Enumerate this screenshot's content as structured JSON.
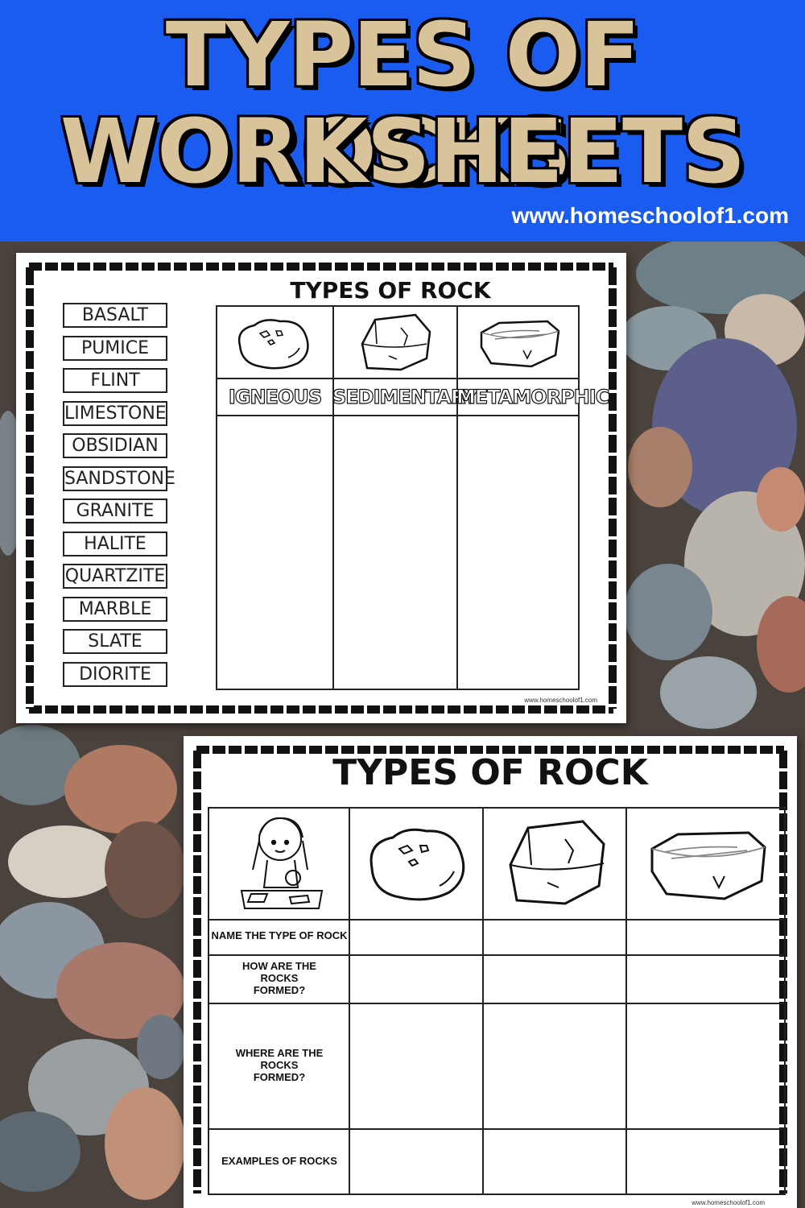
{
  "banner": {
    "title_line1": "TYPES OF ROCKS",
    "title_line2": "WORKSHEETS",
    "url": "www.homeschoolof1.com"
  },
  "worksheet1": {
    "title": "TYPES OF ROCK",
    "words": [
      "BASALT",
      "PUMICE",
      "FLINT",
      "LIMESTONE",
      "OBSIDIAN",
      "SANDSTONE",
      "GRANITE",
      "HALITE",
      "QUARTZITE",
      "MARBLE",
      "SLATE",
      "DIORITE"
    ],
    "categories": [
      "IGNEOUS",
      "SEDIMENTARY",
      "METAMORPHIC"
    ],
    "footer_url": "www.homeschoolof1.com"
  },
  "worksheet2": {
    "title": "TYPES OF ROCK",
    "row_labels": {
      "name": "NAME THE TYPE OF ROCK",
      "how": "HOW ARE THE ROCKS FORMED?",
      "where": "WHERE ARE THE ROCKS FORMED?",
      "examples": "EXAMPLES OF ROCKS"
    },
    "footer_url": "www.homeschoolof1.com"
  },
  "colors": {
    "banner_blue": "#1a5bf0",
    "title_tan": "#d8c39a"
  },
  "icons": [
    "igneous-rock-icon",
    "sedimentary-rock-icon",
    "metamorphic-rock-icon",
    "girl-with-magnifier-icon"
  ]
}
